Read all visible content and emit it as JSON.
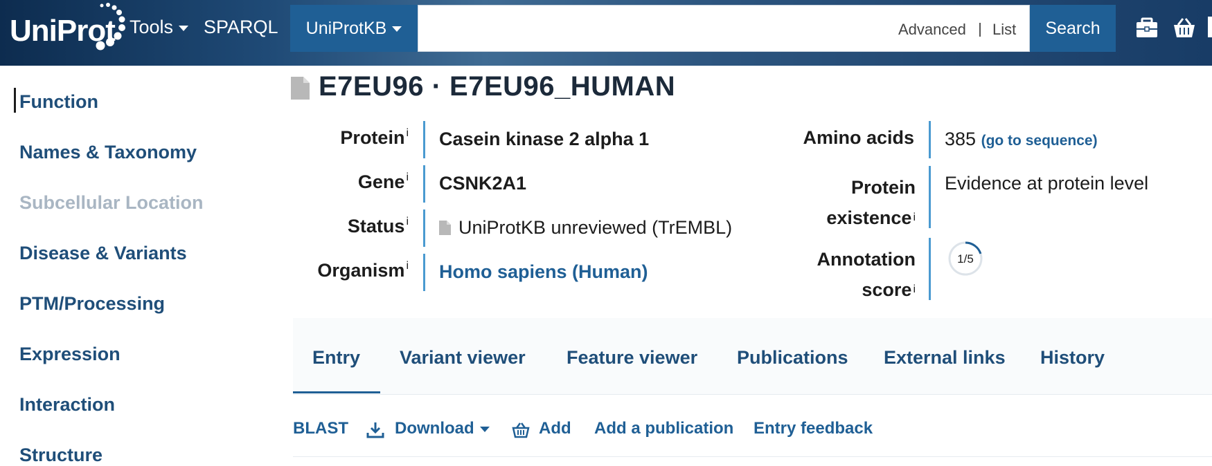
{
  "header": {
    "logo": "UniProt",
    "tools_label": "Tools",
    "sparql_label": "SPARQL",
    "database_label": "UniProtKB",
    "search": {
      "value": "",
      "placeholder": ""
    },
    "advanced_label": "Advanced",
    "list_label": "List",
    "search_button": "Search"
  },
  "sidebar": {
    "items": [
      {
        "label": "Function",
        "state": "active"
      },
      {
        "label": "Names & Taxonomy",
        "state": "normal"
      },
      {
        "label": "Subcellular Location",
        "state": "disabled"
      },
      {
        "label": "Disease & Variants",
        "state": "normal"
      },
      {
        "label": "PTM/Processing",
        "state": "normal"
      },
      {
        "label": "Expression",
        "state": "normal"
      },
      {
        "label": "Interaction",
        "state": "normal"
      },
      {
        "label": "Structure",
        "state": "normal"
      }
    ]
  },
  "entry": {
    "title": "E7EU96 · E7EU96_HUMAN",
    "info_marker": "i",
    "fields": {
      "protein": {
        "label": "Protein",
        "value": "Casein kinase 2 alpha 1"
      },
      "gene": {
        "label": "Gene",
        "value": "CSNK2A1"
      },
      "status": {
        "label": "Status",
        "value": "UniProtKB unreviewed (TrEMBL)"
      },
      "organism": {
        "label": "Organism",
        "value": "Homo sapiens (Human)"
      },
      "amino_acids": {
        "label": "Amino acids",
        "value": "385",
        "link": "(go to sequence)"
      },
      "protein_existence": {
        "label_line1": "Protein",
        "label_line2": "existence",
        "value": "Evidence at protein level"
      },
      "annotation_score": {
        "label_line1": "Annotation",
        "label_line2": "score",
        "value": "1/5",
        "score": 1,
        "max": 5
      }
    }
  },
  "tabs": [
    {
      "label": "Entry",
      "active": true
    },
    {
      "label": "Variant viewer",
      "active": false
    },
    {
      "label": "Feature viewer",
      "active": false
    },
    {
      "label": "Publications",
      "active": false
    },
    {
      "label": "External links",
      "active": false
    },
    {
      "label": "History",
      "active": false
    }
  ],
  "actions": {
    "blast": "BLAST",
    "download": "Download",
    "add": "Add",
    "add_publication": "Add a publication",
    "entry_feedback": "Entry feedback"
  },
  "colors": {
    "header_dark": "#0d2c4f",
    "header_button": "#1f5f95",
    "link": "#1f4e79",
    "field_bar": "#4a9ad0",
    "muted": "#a9b6c3"
  }
}
